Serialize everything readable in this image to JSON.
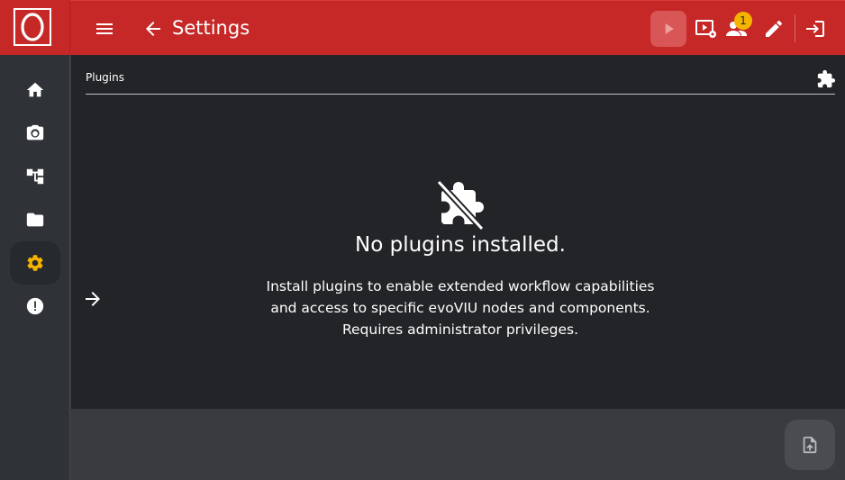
{
  "header": {
    "title": "Settings",
    "notification_count": "1"
  },
  "sidebar": {
    "items": [
      {
        "name": "home",
        "icon": "home-icon"
      },
      {
        "name": "camera",
        "icon": "camera-icon"
      },
      {
        "name": "workflow",
        "icon": "workflow-icon"
      },
      {
        "name": "folder",
        "icon": "folder-icon"
      },
      {
        "name": "settings",
        "icon": "gear-icon",
        "active": true
      },
      {
        "name": "alerts",
        "icon": "alert-icon"
      }
    ]
  },
  "section": {
    "title": "Plugins"
  },
  "empty_state": {
    "title": "No plugins installed.",
    "line1": "Install plugins to enable extended workflow capabilities",
    "line2": "and access to specific evoVIU nodes and components.",
    "line3": "Requires administrator privileges."
  },
  "colors": {
    "brand_red": "#c62828",
    "accent_yellow": "#f5b400",
    "content_bg": "#232428",
    "sidebar_bg": "#2f3237"
  }
}
